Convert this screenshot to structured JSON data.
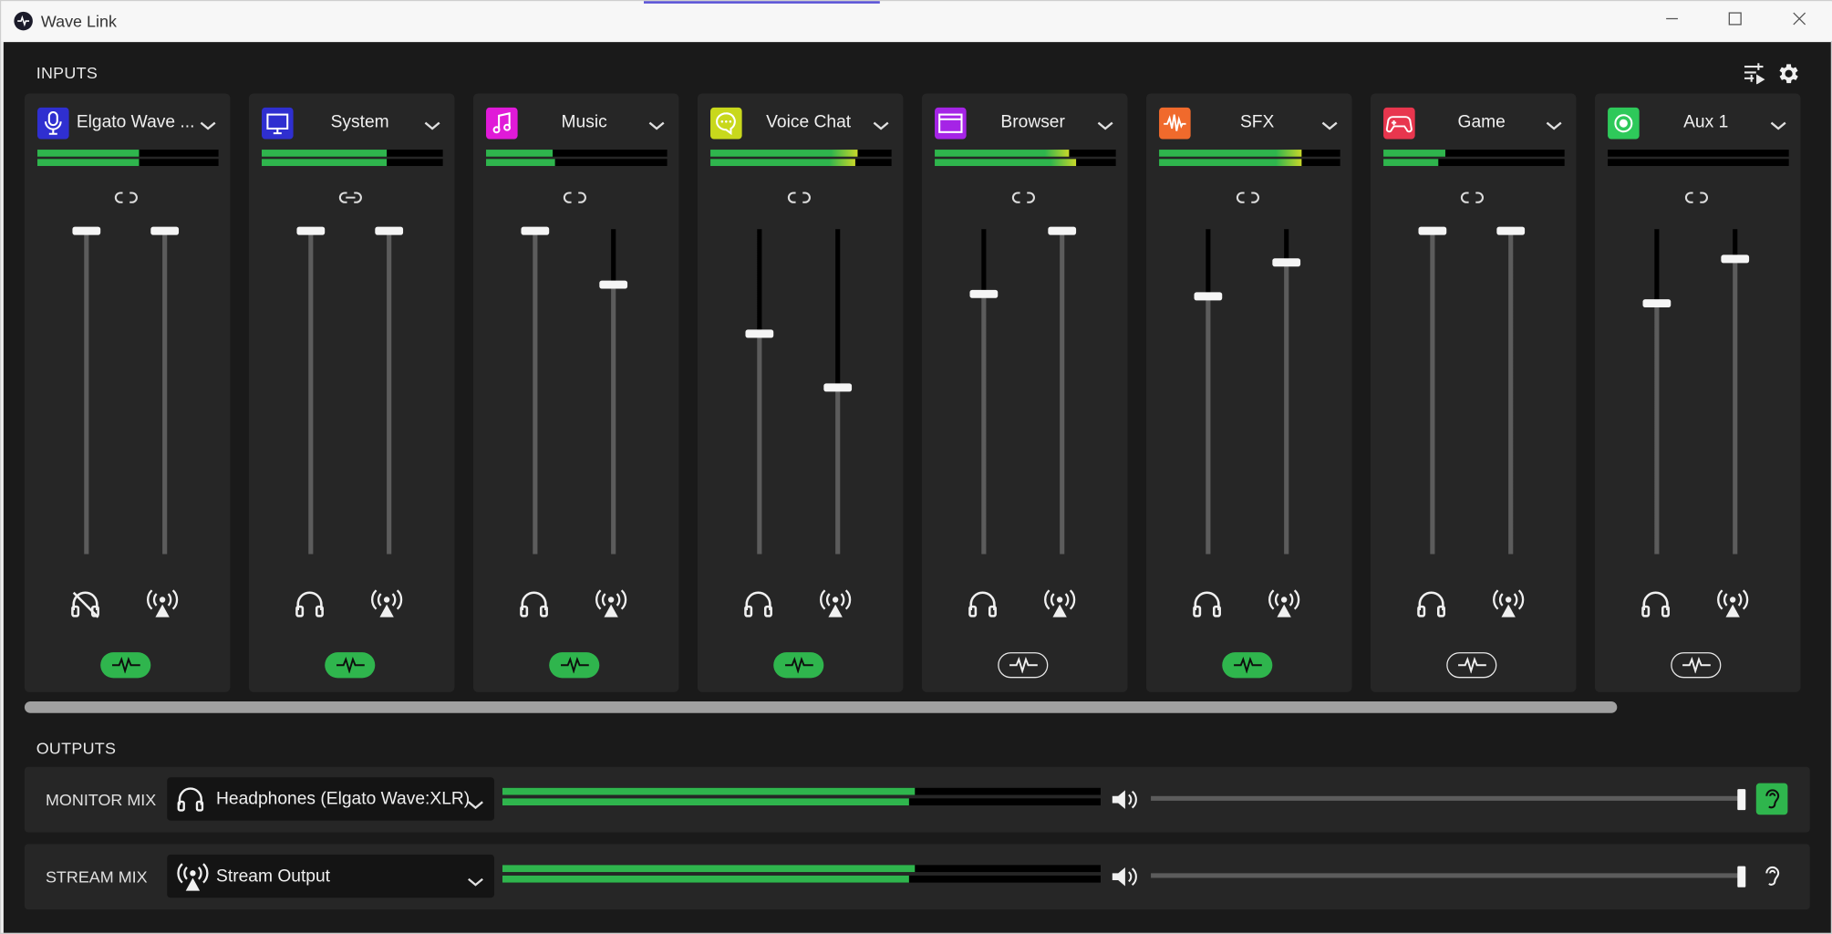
{
  "window": {
    "title": "Wave Link",
    "controls": [
      "minimize-icon",
      "maximize-icon",
      "close-icon"
    ]
  },
  "inputs": {
    "title": "INPUTS",
    "header_icons": [
      "mixer-settings-icon",
      "gear-icon"
    ],
    "channels": [
      {
        "name": "Elgato Wave ...",
        "icon": "microphone-icon",
        "icon_color": "#2f2fd0",
        "meter": [
          0.56,
          0.56
        ],
        "link": "unlinked",
        "monitor_level": 1.0,
        "stream_level": 1.0,
        "monitor_muted": true,
        "fx_active": true
      },
      {
        "name": "System",
        "icon": "monitor-icon",
        "icon_color": "#2f2fd0",
        "meter": [
          0.69,
          0.69
        ],
        "link": "linked",
        "monitor_level": 1.0,
        "stream_level": 1.0,
        "monitor_muted": false,
        "fx_active": true
      },
      {
        "name": "Music",
        "icon": "music-note-icon",
        "icon_color": "#e01ad8",
        "meter": [
          0.37,
          0.38
        ],
        "link": "unlinked",
        "monitor_level": 1.0,
        "stream_level": 0.83,
        "monitor_muted": false,
        "fx_active": true
      },
      {
        "name": "Voice Chat",
        "icon": "chat-bubble-icon",
        "icon_color": "#c8d81c",
        "meter": [
          0.81,
          0.8
        ],
        "link": "unlinked",
        "monitor_level": 0.67,
        "stream_level": 0.5,
        "monitor_muted": false,
        "fx_active": true
      },
      {
        "name": "Browser",
        "icon": "browser-window-icon",
        "icon_color": "#a524e6",
        "meter": [
          0.74,
          0.78
        ],
        "link": "unlinked",
        "monitor_level": 0.8,
        "stream_level": 1.0,
        "monitor_muted": false,
        "fx_active": false
      },
      {
        "name": "SFX",
        "icon": "waveform-icon",
        "icon_color": "#f06a2c",
        "meter": [
          0.79,
          0.79
        ],
        "link": "unlinked",
        "monitor_level": 0.79,
        "stream_level": 0.9,
        "monitor_muted": false,
        "fx_active": true
      },
      {
        "name": "Game",
        "icon": "gamepad-icon",
        "icon_color": "#e8364e",
        "meter": [
          0.34,
          0.3
        ],
        "link": "unlinked",
        "monitor_level": 1.0,
        "stream_level": 1.0,
        "monitor_muted": false,
        "fx_active": false
      },
      {
        "name": "Aux 1",
        "icon": "record-icon",
        "icon_color": "#2ec95a",
        "meter": [
          0.0,
          0.0
        ],
        "link": "unlinked",
        "monitor_level": 0.77,
        "stream_level": 0.91,
        "monitor_muted": false,
        "fx_active": false
      }
    ]
  },
  "outputs": {
    "title": "OUTPUTS",
    "mixes": [
      {
        "label": "MONITOR MIX",
        "device": "Headphones (Elgato Wave:XLR)",
        "device_icon": "headphones-icon",
        "meter": [
          0.69,
          0.68
        ],
        "volume": 1.0,
        "listen_active": true
      },
      {
        "label": "STREAM MIX",
        "device": "Stream Output",
        "device_icon": "broadcast-icon",
        "meter": [
          0.69,
          0.68
        ],
        "volume": 1.0,
        "listen_active": false
      }
    ]
  },
  "colors": {
    "accent_green": "#2fb54d",
    "meter_yellow": "#c8d82a",
    "panel": "#262626",
    "background": "#1a1a1a"
  }
}
